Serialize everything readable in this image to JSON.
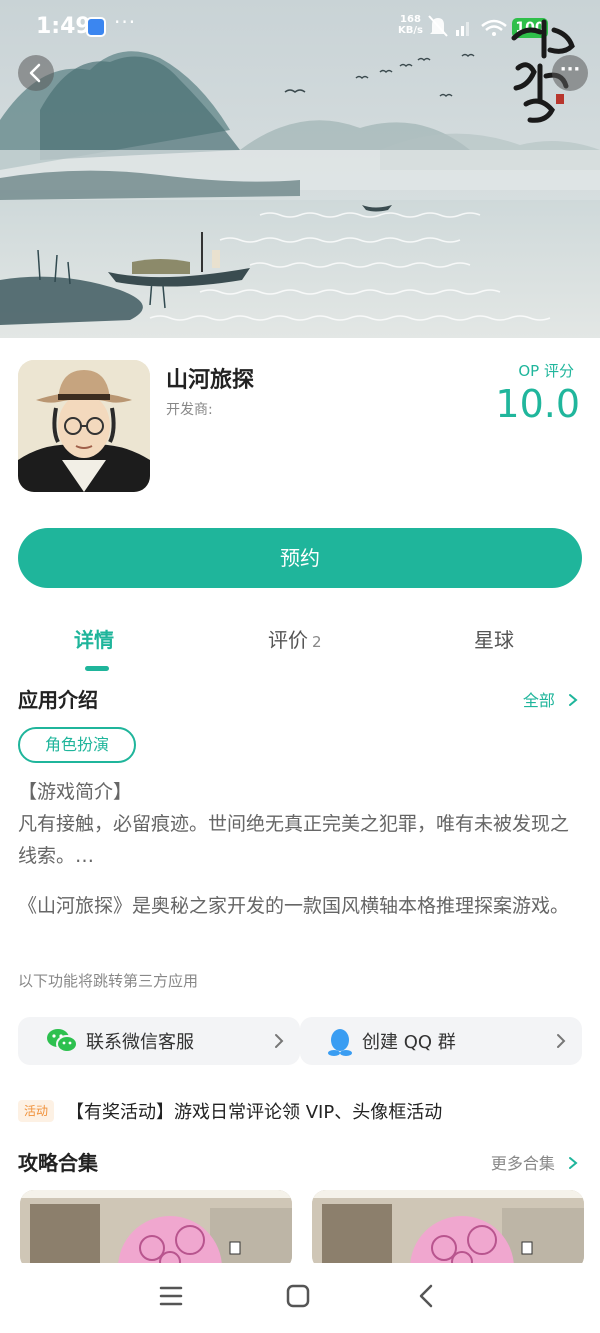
{
  "status_bar": {
    "time": "1:49",
    "speed_value": "168",
    "speed_unit": "KB/s",
    "battery": "100"
  },
  "hero": {
    "calligraphy_icon": "game-logo-calligraphy"
  },
  "app": {
    "title": "山河旅探",
    "developer_label": "开发商:",
    "score_label": "OP 评分",
    "score_value": "10.0",
    "reserve_label": "预约"
  },
  "tabs": [
    {
      "label": "详情"
    },
    {
      "label": "评价",
      "count": "2"
    },
    {
      "label": "星球"
    }
  ],
  "intro": {
    "title": "应用介绍",
    "all_link": "全部",
    "tag": "角色扮演",
    "heading": "【游戏简介】",
    "summary": "凡有接触，必留痕迹。世间绝无真正完美之犯罪，唯有未被发现之线索。…",
    "description": "《山河旅探》是奥秘之家开发的一款国风横轴本格推理探案游戏。",
    "notice": "以下功能将跳转第三方应用"
  },
  "links": [
    {
      "label": "联系微信客服",
      "icon": "wechat-icon"
    },
    {
      "label": "创建 QQ 群",
      "icon": "qq-icon"
    }
  ],
  "activity": {
    "badge": "活动",
    "text": "【有奖活动】游戏日常评论领 VIP、头像框活动"
  },
  "guides": {
    "title": "攻略合集",
    "more_link": "更多合集"
  },
  "colors": {
    "accent": "#1fb59b",
    "activity": "#f0913a"
  }
}
